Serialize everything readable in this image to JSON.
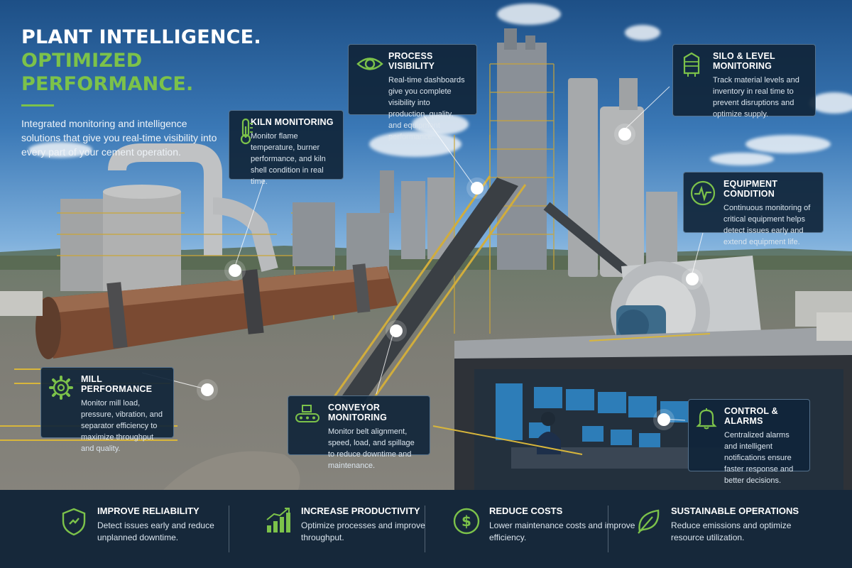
{
  "headline": {
    "line1": "PLANT INTELLIGENCE.",
    "line2": "OPTIMIZED PERFORMANCE.",
    "intro": "Integrated monitoring and intelligence solutions that give you real-time visibility into every part of your cement operation."
  },
  "colors": {
    "accent_green": "#7cc24a",
    "card_bg": "#10253a",
    "bar_bg": "#102337"
  },
  "cards": {
    "process_visibility": {
      "icon": "eye-icon",
      "title": "PROCESS VISIBILITY",
      "desc": "Real-time dashboards give you complete visibility into production, quality, and equipment performance."
    },
    "kiln_monitoring": {
      "icon": "thermometer-icon",
      "title": "KILN MONITORING",
      "desc": "Monitor flame temperature, burner performance, and kiln shell condition in real time."
    },
    "silo_level": {
      "icon": "silo-icon",
      "title": "SILO & LEVEL MONITORING",
      "desc": "Track material levels and inventory in real time to prevent disruptions and optimize supply."
    },
    "equipment_condition": {
      "icon": "pulse-icon",
      "title": "EQUIPMENT CONDITION",
      "desc": "Continuous monitoring of critical equipment helps detect issues early and extend equipment life."
    },
    "mill_performance": {
      "icon": "gear-icon",
      "title": "MILL PERFORMANCE",
      "desc": "Monitor mill load, pressure, vibration, and separator efficiency to maximize throughput and quality."
    },
    "conveyor_monitoring": {
      "icon": "conveyor-icon",
      "title": "CONVEYOR MONITORING",
      "desc": "Monitor belt alignment, speed, load, and spillage to reduce downtime and maintenance."
    },
    "control_alarms": {
      "icon": "bell-icon",
      "title": "CONTROL & ALARMS",
      "desc": "Centralized alarms and intelligent notifications ensure faster response and better decisions."
    }
  },
  "benefits": [
    {
      "icon": "shield-icon",
      "title": "IMPROVE RELIABILITY",
      "desc": "Detect issues early and reduce unplanned downtime."
    },
    {
      "icon": "bar-chart-icon",
      "title": "INCREASE PRODUCTIVITY",
      "desc": "Optimize processes and improve throughput."
    },
    {
      "icon": "dollar-icon",
      "title": "REDUCE COSTS",
      "desc": "Lower maintenance costs and improve efficiency."
    },
    {
      "icon": "leaf-icon",
      "title": "SUSTAINABLE OPERATIONS",
      "desc": "Reduce emissions and optimize resource utilization."
    }
  ]
}
